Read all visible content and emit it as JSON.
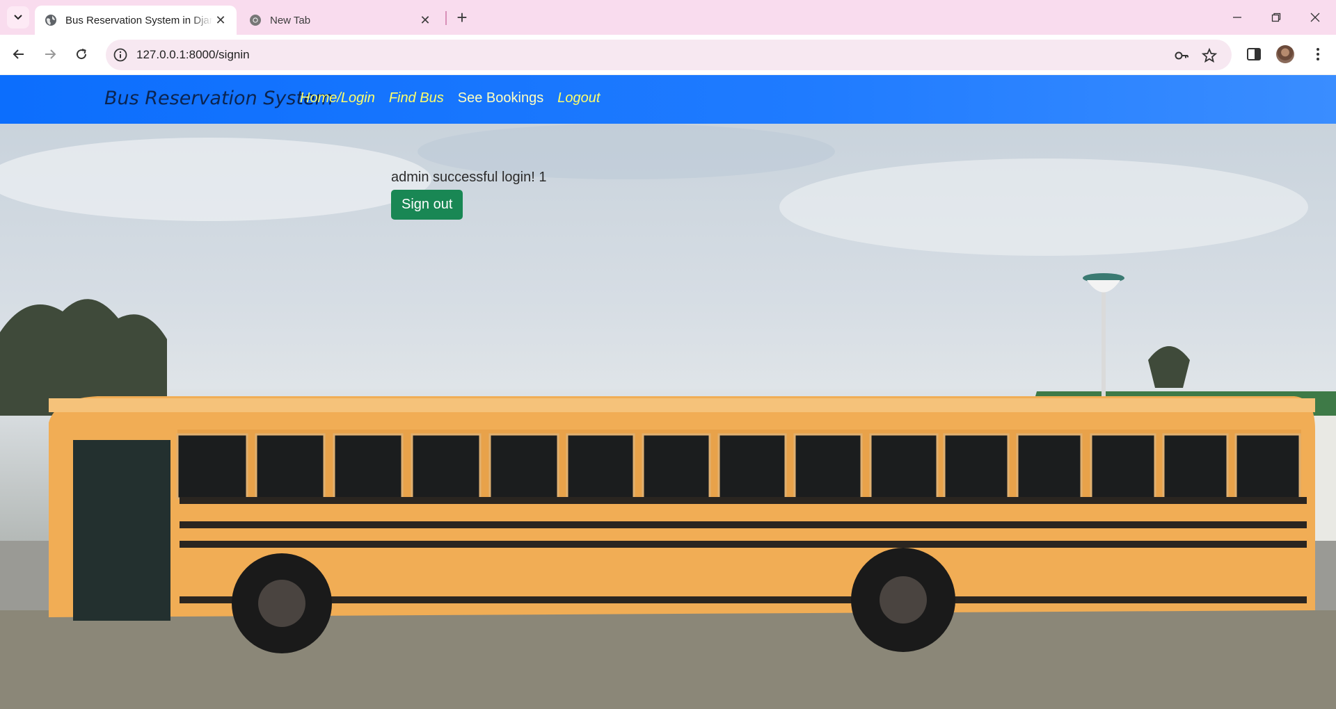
{
  "browser": {
    "tabs": [
      {
        "title": "Bus Reservation System in Django",
        "active": true
      },
      {
        "title": "New Tab",
        "active": false
      }
    ],
    "url": "127.0.0.1:8000/signin"
  },
  "navbar": {
    "brand": "Bus Reservation System",
    "links": [
      "Home/Login",
      "Find Bus",
      "See Bookings",
      "Logout"
    ]
  },
  "main": {
    "message": "admin successful login! 1",
    "signout_label": "Sign out"
  },
  "colors": {
    "navbar": "#0d6efd",
    "link_yellow": "#ffff66",
    "signout_button": "#198754"
  }
}
